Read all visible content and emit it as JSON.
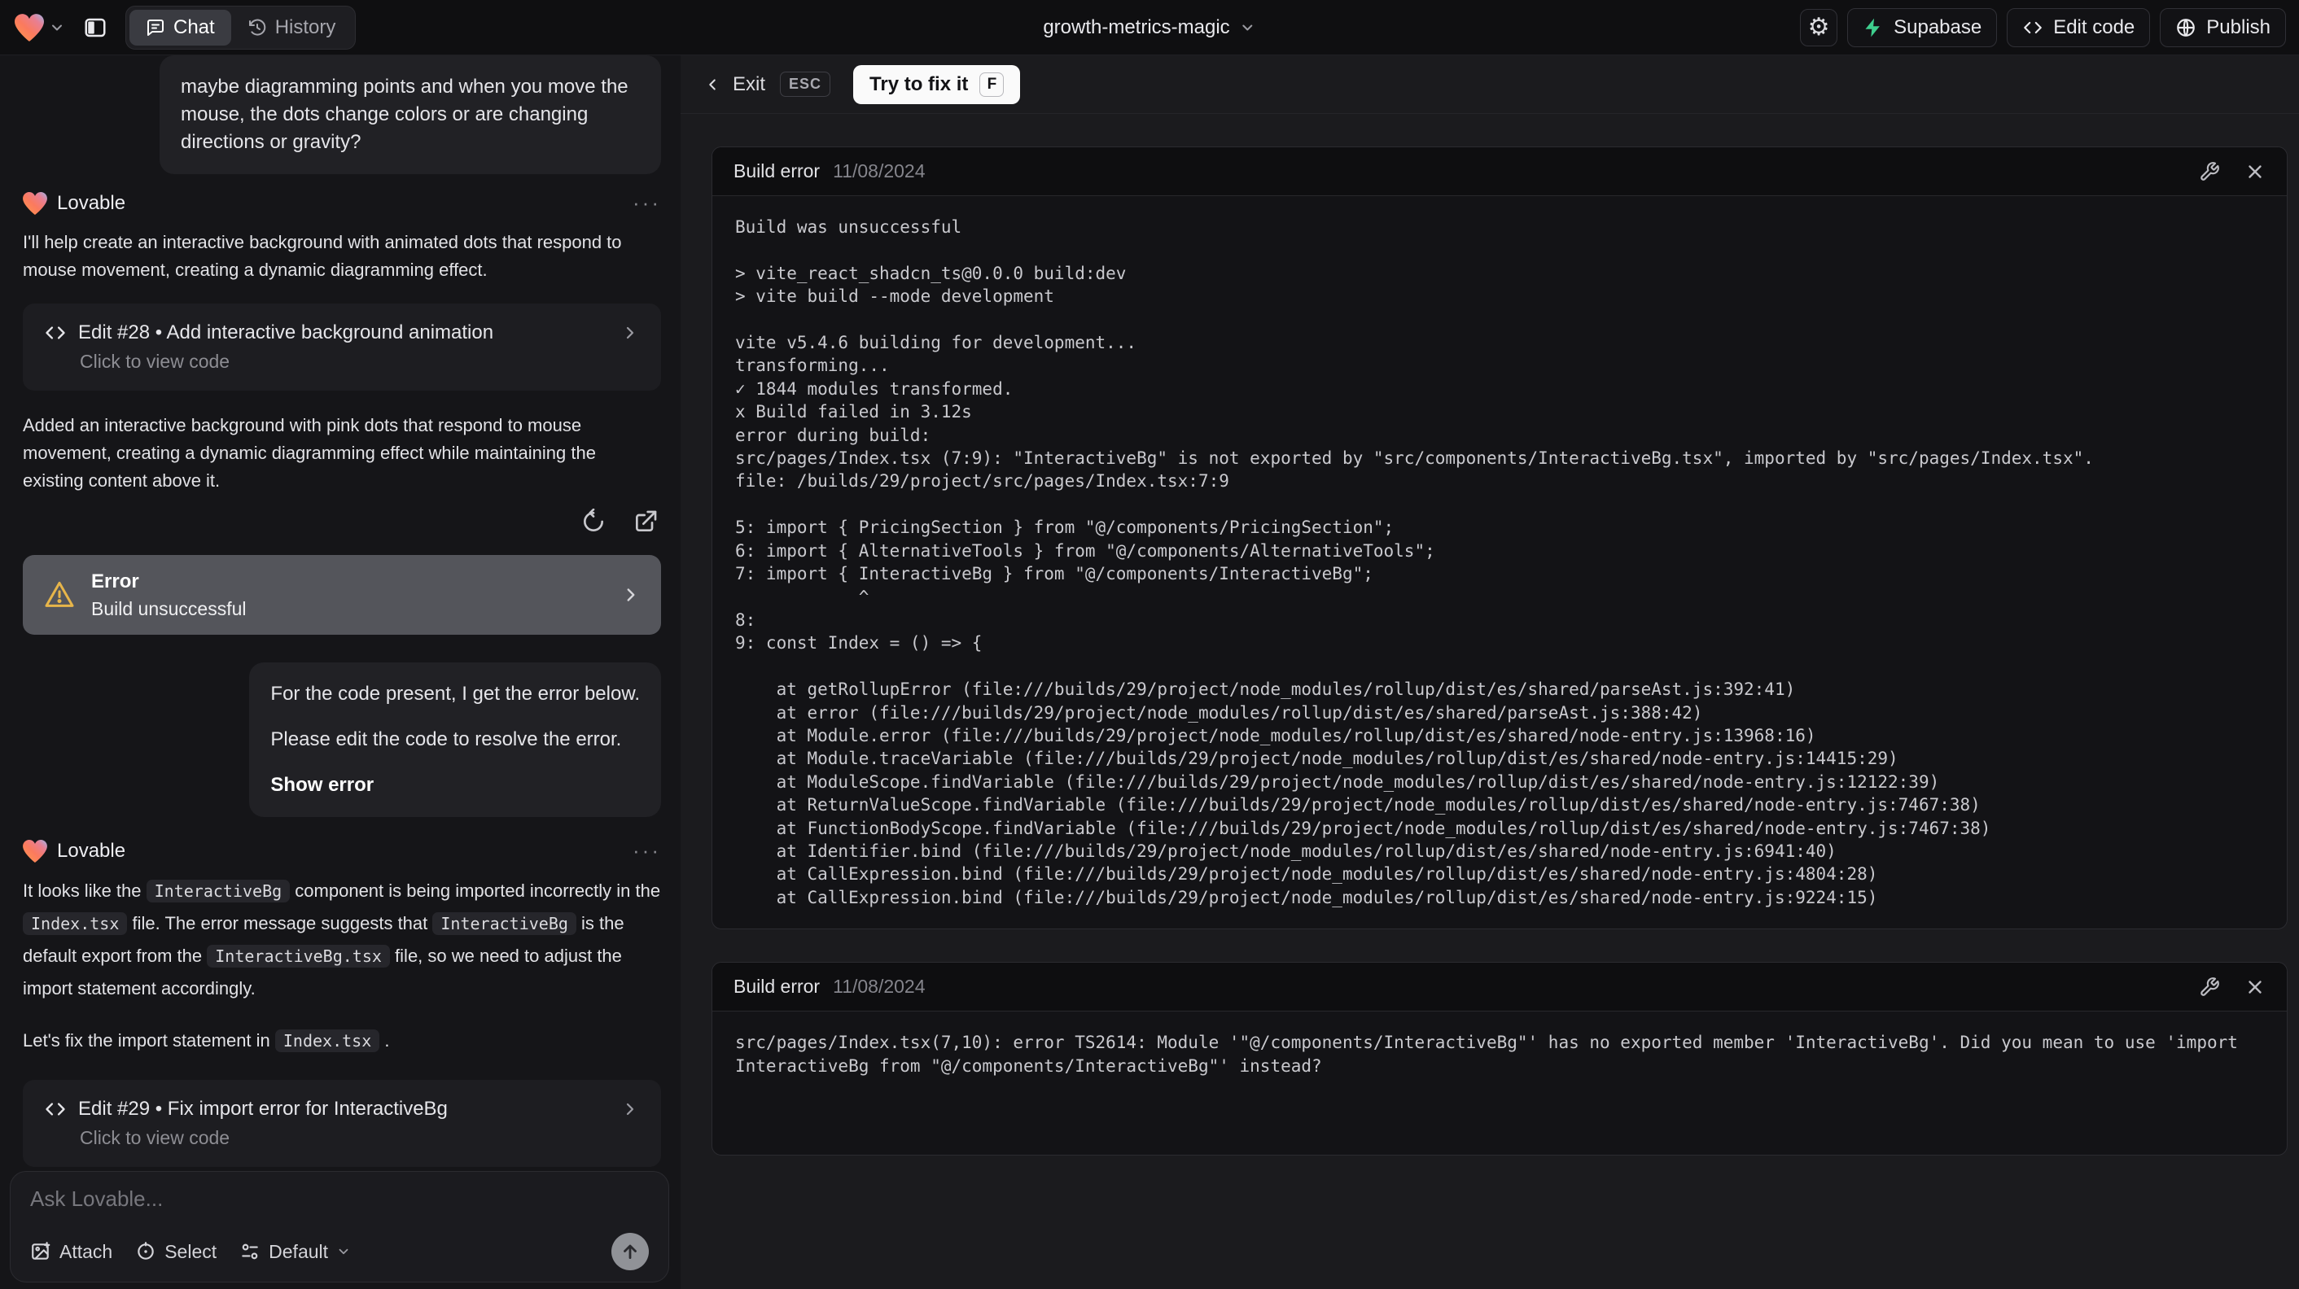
{
  "topbar": {
    "project_name": "growth-metrics-magic",
    "tab_chat": "Chat",
    "tab_history": "History",
    "btn_supabase": "Supabase",
    "btn_edit_code": "Edit code",
    "btn_publish": "Publish"
  },
  "chat": {
    "assistant_name": "Lovable",
    "menu_dots": "···",
    "user_message_1": "maybe diagramming points and when you move the mouse, the dots change colors or are changing directions or gravity?",
    "assistant_intro": "I'll help create an interactive background with animated dots that respond to mouse movement, creating a dynamic diagramming effect.",
    "edit_card_1": {
      "title": "Edit #28 • Add interactive background animation",
      "subtitle": "Click to view code"
    },
    "assistant_followup": "Added an interactive background with pink dots that respond to mouse movement, creating a dynamic diagramming effect while maintaining the existing content above it.",
    "error_card": {
      "title": "Error",
      "subtitle": "Build unsuccessful"
    },
    "user_message_2": {
      "line1": "For the code present, I get the error below.",
      "line2": "Please edit the code to resolve the error.",
      "action": "Show error"
    },
    "assistant_diagnosis": [
      {
        "t": "It looks like the "
      },
      {
        "c": "InteractiveBg"
      },
      {
        "t": " component is being imported incorrectly in the "
      },
      {
        "c": "Index.tsx"
      },
      {
        "t": " file. The error message suggests that "
      },
      {
        "c": "InteractiveBg"
      },
      {
        "t": " is the default export from the "
      },
      {
        "c": "InteractiveBg.tsx"
      },
      {
        "t": " file, so we need to adjust the import statement accordingly."
      }
    ],
    "assistant_fix": [
      {
        "t": "Let's fix the import statement in "
      },
      {
        "c": "Index.tsx"
      },
      {
        "t": " ."
      }
    ],
    "edit_card_2": {
      "title": "Edit #29 • Fix import error for InteractiveBg",
      "subtitle": "Click to view code"
    },
    "input": {
      "placeholder": "Ask Lovable...",
      "attach": "Attach",
      "select": "Select",
      "model": "Default"
    }
  },
  "error_overlay": {
    "exit": "Exit",
    "esc": "ESC",
    "fix_button": "Try to fix it",
    "fix_key": "F",
    "panel1": {
      "title": "Build error",
      "date": "11/08/2024",
      "log_lines": [
        "Build was unsuccessful",
        "",
        "> vite_react_shadcn_ts@0.0.0 build:dev",
        "> vite build --mode development",
        "",
        "vite v5.4.6 building for development...",
        "transforming...",
        "✓ 1844 modules transformed.",
        "x Build failed in 3.12s",
        "error during build:",
        "src/pages/Index.tsx (7:9): \"InteractiveBg\" is not exported by \"src/components/InteractiveBg.tsx\", imported by \"src/pages/Index.tsx\".",
        "file: /builds/29/project/src/pages/Index.tsx:7:9",
        "",
        "5: import { PricingSection } from \"@/components/PricingSection\";",
        "6: import { AlternativeTools } from \"@/components/AlternativeTools\";",
        "7: import { InteractiveBg } from \"@/components/InteractiveBg\";",
        "            ^",
        "8:",
        "9: const Index = () => {",
        "",
        "    at getRollupError (file:///builds/29/project/node_modules/rollup/dist/es/shared/parseAst.js:392:41)",
        "    at error (file:///builds/29/project/node_modules/rollup/dist/es/shared/parseAst.js:388:42)",
        "    at Module.error (file:///builds/29/project/node_modules/rollup/dist/es/shared/node-entry.js:13968:16)",
        "    at Module.traceVariable (file:///builds/29/project/node_modules/rollup/dist/es/shared/node-entry.js:14415:29)",
        "    at ModuleScope.findVariable (file:///builds/29/project/node_modules/rollup/dist/es/shared/node-entry.js:12122:39)",
        "    at ReturnValueScope.findVariable (file:///builds/29/project/node_modules/rollup/dist/es/shared/node-entry.js:7467:38)",
        "    at FunctionBodyScope.findVariable (file:///builds/29/project/node_modules/rollup/dist/es/shared/node-entry.js:7467:38)",
        "    at Identifier.bind (file:///builds/29/project/node_modules/rollup/dist/es/shared/node-entry.js:6941:40)",
        "    at CallExpression.bind (file:///builds/29/project/node_modules/rollup/dist/es/shared/node-entry.js:4804:28)",
        "    at CallExpression.bind (file:///builds/29/project/node_modules/rollup/dist/es/shared/node-entry.js:9224:15)"
      ]
    },
    "panel2": {
      "title": "Build error",
      "date": "11/08/2024",
      "log_lines": [
        "src/pages/Index.tsx(7,10): error TS2614: Module '\"@/components/InteractiveBg\"' has no exported member 'InteractiveBg'. Did you mean to use 'import InteractiveBg from \"@/components/InteractiveBg\"' instead?"
      ]
    }
  },
  "colors": {
    "warning_amber": "#e7b54a",
    "supabase_green": "#3ecf8e"
  }
}
